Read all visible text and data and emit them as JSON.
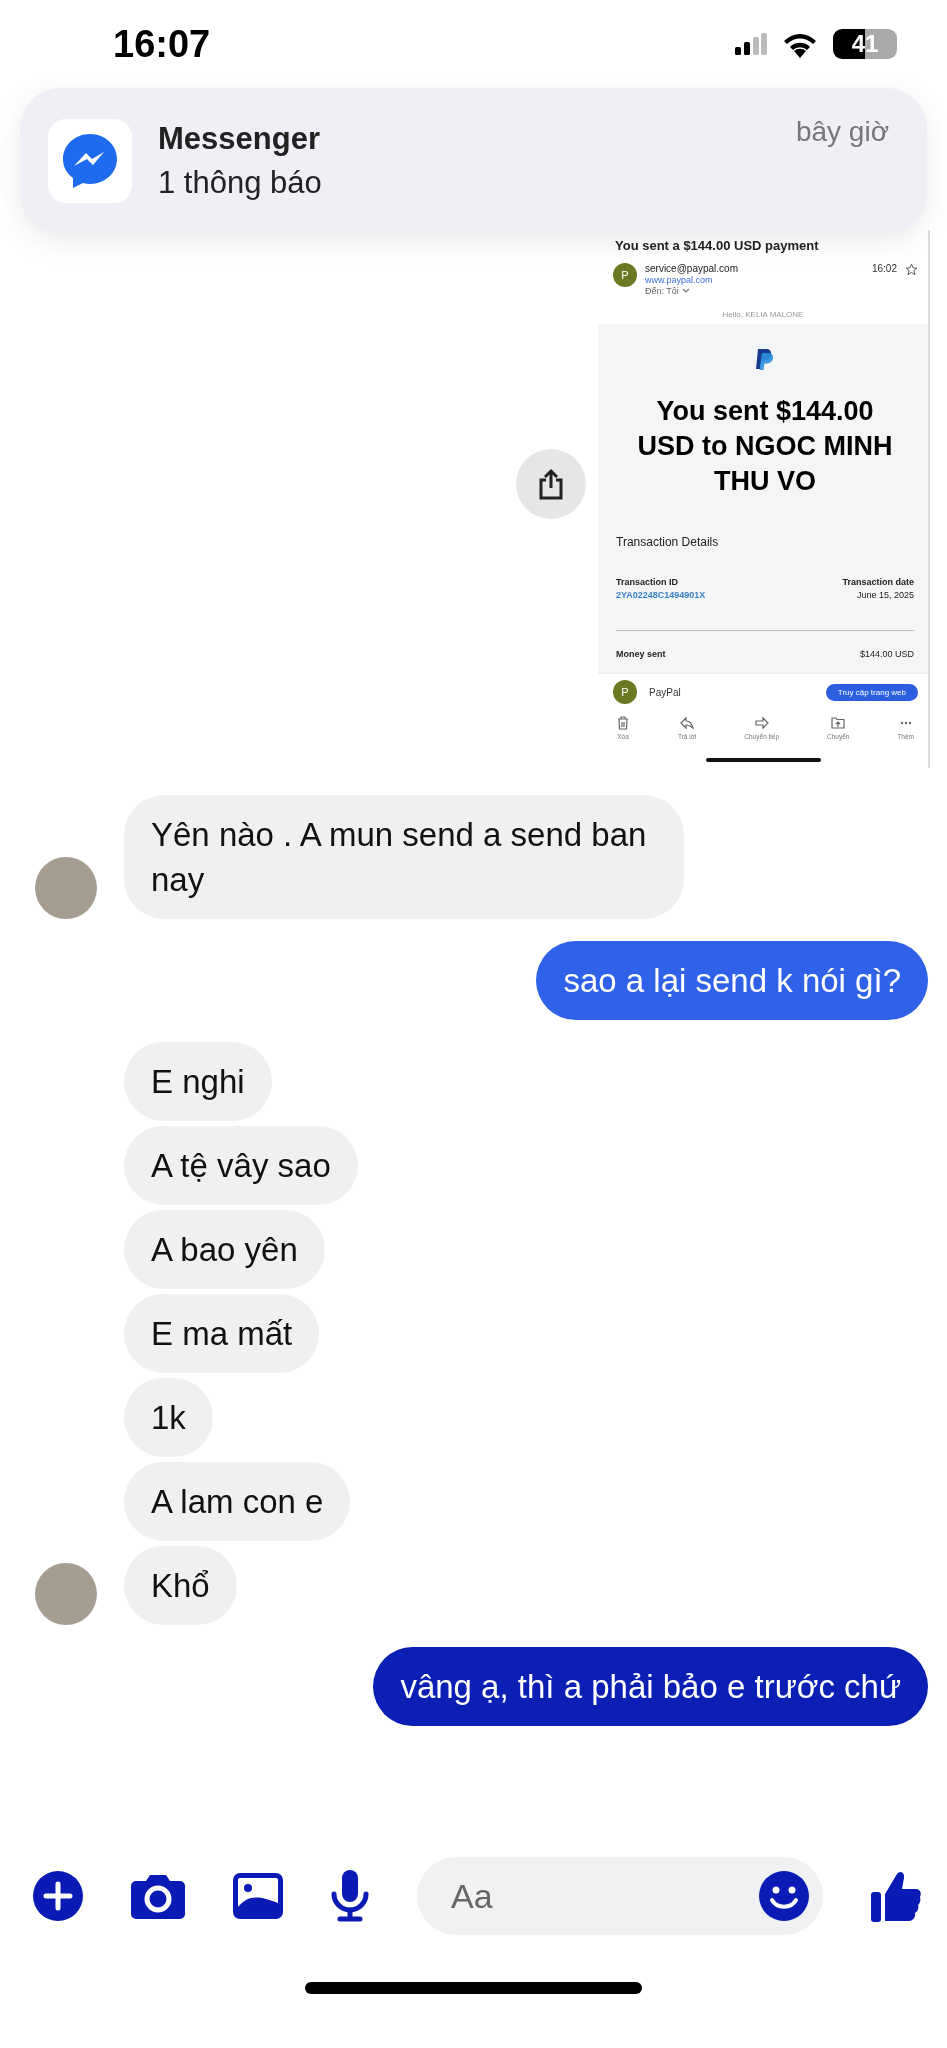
{
  "status_bar": {
    "time": "16:07",
    "battery": "41"
  },
  "notification": {
    "app": "Messenger",
    "text": "1 thông báo",
    "time": "bây giờ"
  },
  "shared_image": {
    "subject": "You sent a $144.00 USD payment",
    "sender_initial": "P",
    "from": "service@paypal.com",
    "link": "www.paypal.com",
    "to": "Đến: Tôi",
    "time": "16:02",
    "greeting": "Hello, KELIA MALONE",
    "headline": "You sent $144.00 USD to NGOC MINH THU VO",
    "section": "Transaction Details",
    "id_label": "Transaction ID",
    "id": "2YA02248C1494901X",
    "date_label": "Transaction date",
    "date": "June 15, 2025",
    "money_label": "Money sent",
    "money": "$144.00 USD",
    "footer_initial": "P",
    "footer_name": "PayPal",
    "footer_button": "Truy cập trang web",
    "toolbar": [
      {
        "kind": "trash",
        "label": "Xóa"
      },
      {
        "kind": "reply",
        "label": "Trả lời"
      },
      {
        "kind": "forward",
        "label": "Chuyển tiếp"
      },
      {
        "kind": "move",
        "label": "Chuyển"
      },
      {
        "kind": "more",
        "label": "Thêm"
      }
    ]
  },
  "messages": [
    {
      "kind": "received",
      "text": "Yên nào . A mun send a send ban nay",
      "avatar": true
    },
    {
      "kind": "sent",
      "text": "sao a lại send k nói gì?",
      "color": "#2f62e9"
    },
    {
      "kind": "received",
      "text": "E nghi",
      "avatar": false
    },
    {
      "kind": "received",
      "text": "A tệ vây sao",
      "avatar": false
    },
    {
      "kind": "received",
      "text": "A bao yên",
      "avatar": false
    },
    {
      "kind": "received",
      "text": "E ma mất",
      "avatar": false
    },
    {
      "kind": "received",
      "text": "1k",
      "avatar": false
    },
    {
      "kind": "received",
      "text": "A lam con e",
      "avatar": false
    },
    {
      "kind": "received",
      "text": "Khổ",
      "avatar": true
    },
    {
      "kind": "sent",
      "text": "vâng ạ, thì a phải bảo e trước chứ",
      "color": "#0b1fb4"
    }
  ],
  "composer": {
    "placeholder": "Aa"
  }
}
